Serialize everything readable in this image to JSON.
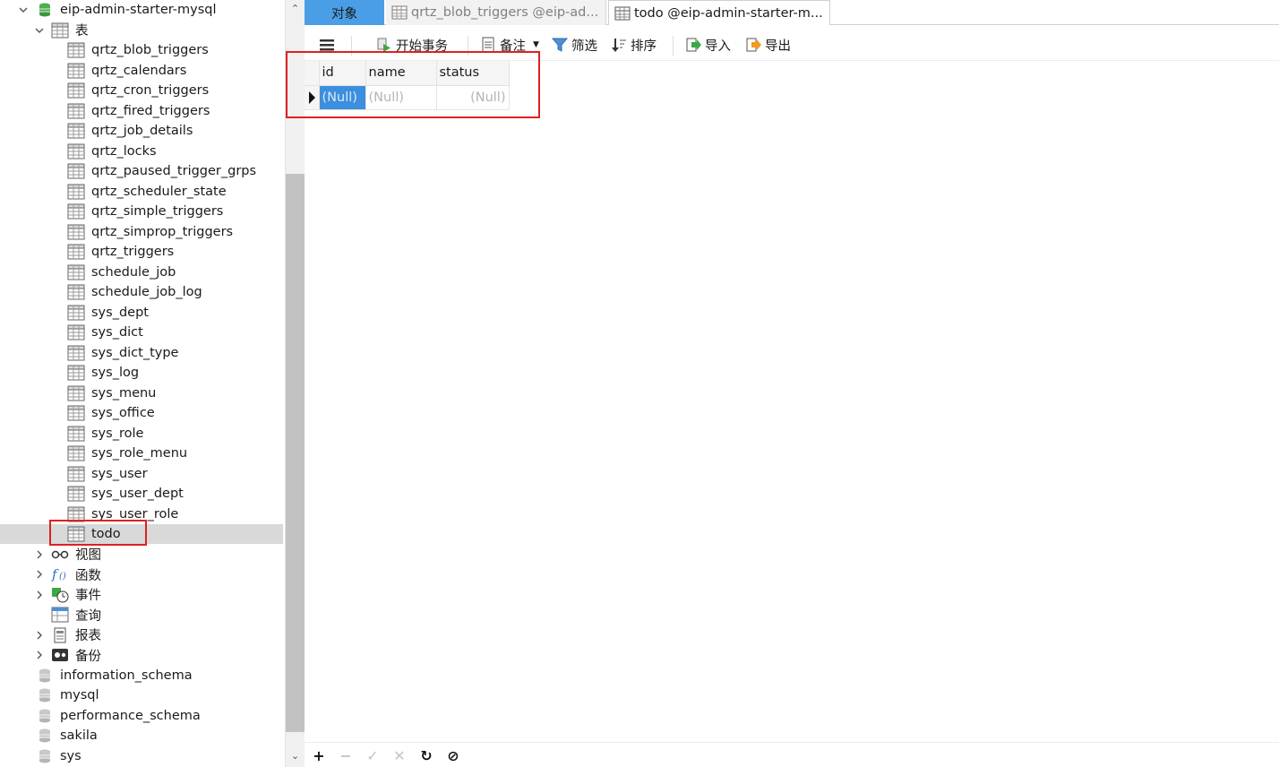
{
  "tree": {
    "db_root": "eip-admin-starter-mysql",
    "tables_group": "表",
    "tables": [
      "qrtz_blob_triggers",
      "qrtz_calendars",
      "qrtz_cron_triggers",
      "qrtz_fired_triggers",
      "qrtz_job_details",
      "qrtz_locks",
      "qrtz_paused_trigger_grps",
      "qrtz_scheduler_state",
      "qrtz_simple_triggers",
      "qrtz_simprop_triggers",
      "qrtz_triggers",
      "schedule_job",
      "schedule_job_log",
      "sys_dept",
      "sys_dict",
      "sys_dict_type",
      "sys_log",
      "sys_menu",
      "sys_office",
      "sys_role",
      "sys_role_menu",
      "sys_user",
      "sys_user_dept",
      "sys_user_role",
      "todo"
    ],
    "selected_table": "todo",
    "groups": [
      {
        "label": "视图",
        "icon": "view-glasses-icon",
        "expandable": true
      },
      {
        "label": "函数",
        "icon": "function-icon",
        "expandable": true
      },
      {
        "label": "事件",
        "icon": "event-clock-icon",
        "expandable": true
      },
      {
        "label": "查询",
        "icon": "query-icon",
        "expandable": false
      },
      {
        "label": "报表",
        "icon": "report-icon",
        "expandable": true
      },
      {
        "label": "备份",
        "icon": "backup-icon",
        "expandable": true
      }
    ],
    "other_databases": [
      "information_schema",
      "mysql",
      "performance_schema",
      "sakila",
      "sys"
    ]
  },
  "tabs": [
    {
      "label": "对象",
      "active": false
    },
    {
      "label": "qrtz_blob_triggers @eip-ad...",
      "active": false
    },
    {
      "label": "todo @eip-admin-starter-m...",
      "active": true
    }
  ],
  "toolbar": {
    "begin_transaction": "开始事务",
    "note": "备注",
    "filter": "筛选",
    "sort": "排序",
    "import": "导入",
    "export": "导出"
  },
  "grid": {
    "columns": [
      "id",
      "name",
      "status"
    ],
    "rows": [
      [
        "(Null)",
        "(Null)",
        "(Null)"
      ]
    ]
  },
  "colors": {
    "tab_active_accent": "#4a9ee6",
    "selected_cell": "#3c8ede",
    "highlight_box": "#e02020",
    "db_icon_green": "#4caf50"
  }
}
